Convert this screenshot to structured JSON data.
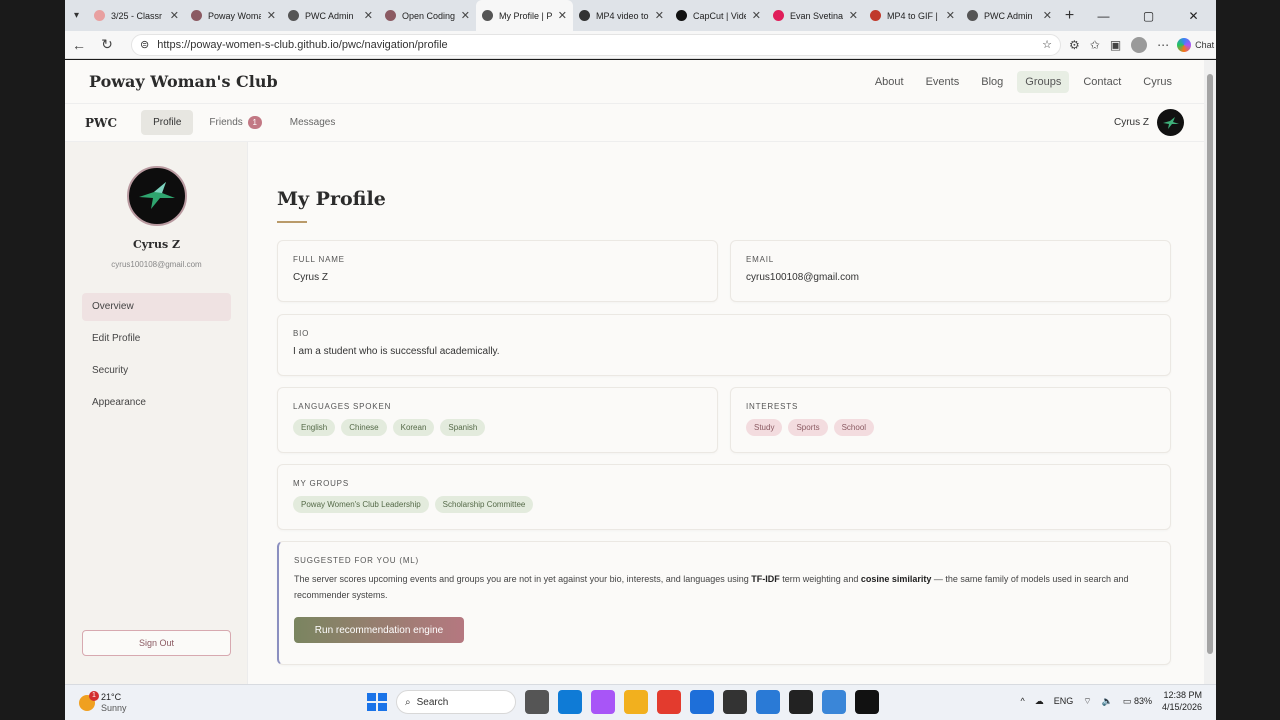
{
  "browser": {
    "tabs": [
      {
        "label": "3/25 - Classr",
        "icon": "classroom-icon",
        "color": "#e8a0a0",
        "active": false
      },
      {
        "label": "Poway Woma",
        "icon": "site-icon",
        "color": "#8b5a62",
        "active": false
      },
      {
        "label": "PWC Admin",
        "icon": "globe-icon",
        "color": "#555555",
        "active": false
      },
      {
        "label": "Open Coding",
        "icon": "site-icon",
        "color": "#8b5a62",
        "active": false
      },
      {
        "label": "My Profile | P",
        "icon": "globe-icon",
        "color": "#555555",
        "active": true
      },
      {
        "label": "MP4 video to",
        "icon": "video-icon",
        "color": "#333333",
        "active": false
      },
      {
        "label": "CapCut | Vide",
        "icon": "capcut-icon",
        "color": "#111111",
        "active": false
      },
      {
        "label": "Evan Svetina",
        "icon": "slack-icon",
        "color": "#e01e5a",
        "active": false
      },
      {
        "label": "MP4 to GIF | ",
        "icon": "cloud-icon",
        "color": "#c0392b",
        "active": false
      },
      {
        "label": "PWC Admin",
        "icon": "globe-icon",
        "color": "#555555",
        "active": false
      }
    ],
    "url": "https://poway-women-s-club.github.io/pwc/navigation/profile",
    "copilot_label": "Chat"
  },
  "site": {
    "title": "Poway Woman's Club",
    "nav": [
      "About",
      "Events",
      "Blog",
      "Groups",
      "Contact",
      "Cyrus"
    ],
    "subnav": {
      "brand": "PWC",
      "tabs": [
        {
          "label": "Profile"
        },
        {
          "label": "Friends",
          "badge": "1"
        },
        {
          "label": "Messages"
        }
      ],
      "user_name": "Cyrus Z"
    }
  },
  "sidebar": {
    "name": "Cyrus Z",
    "email": "cyrus100108@gmail.com",
    "menu": [
      "Overview",
      "Edit Profile",
      "Security",
      "Appearance"
    ],
    "sign_out": "Sign Out"
  },
  "profile": {
    "page_title": "My Profile",
    "full_name": {
      "label": "Full Name",
      "value": "Cyrus Z"
    },
    "email": {
      "label": "Email",
      "value": "cyrus100108@gmail.com"
    },
    "bio": {
      "label": "Bio",
      "value": "I am a student who is successful academically."
    },
    "languages": {
      "label": "Languages Spoken",
      "items": [
        "English",
        "Chinese",
        "Korean",
        "Spanish"
      ]
    },
    "interests": {
      "label": "Interests",
      "items": [
        "Study",
        "Sports",
        "School"
      ]
    },
    "groups": {
      "label": "My Groups",
      "items": [
        "Poway Women's Club Leadership",
        "Scholarship Committee"
      ]
    },
    "suggested": {
      "label": "Suggested for you (ML)",
      "text_1": "The server scores upcoming events and groups you are not in yet against your bio, interests, and languages using ",
      "bold_1": "TF-IDF",
      "text_2": " term weighting and ",
      "bold_2": "cosine similarity",
      "text_3": " — the same family of models used in search and recommender systems.",
      "button": "Run recommendation engine"
    }
  },
  "taskbar": {
    "weather_temp": "21°C",
    "weather_cond": "Sunny",
    "weather_badge": "1",
    "search_label": "Search",
    "language": "ENG",
    "battery": "83%",
    "time": "12:38 PM",
    "date": "4/15/2026",
    "apps": [
      "file-explorer-icon",
      "edge-icon",
      "copilot-icon",
      "folder-icon",
      "chrome-icon",
      "store-icon",
      "terminal-icon",
      "vscode-icon",
      "notepad-icon",
      "photos-icon",
      "capcut-icon"
    ]
  }
}
